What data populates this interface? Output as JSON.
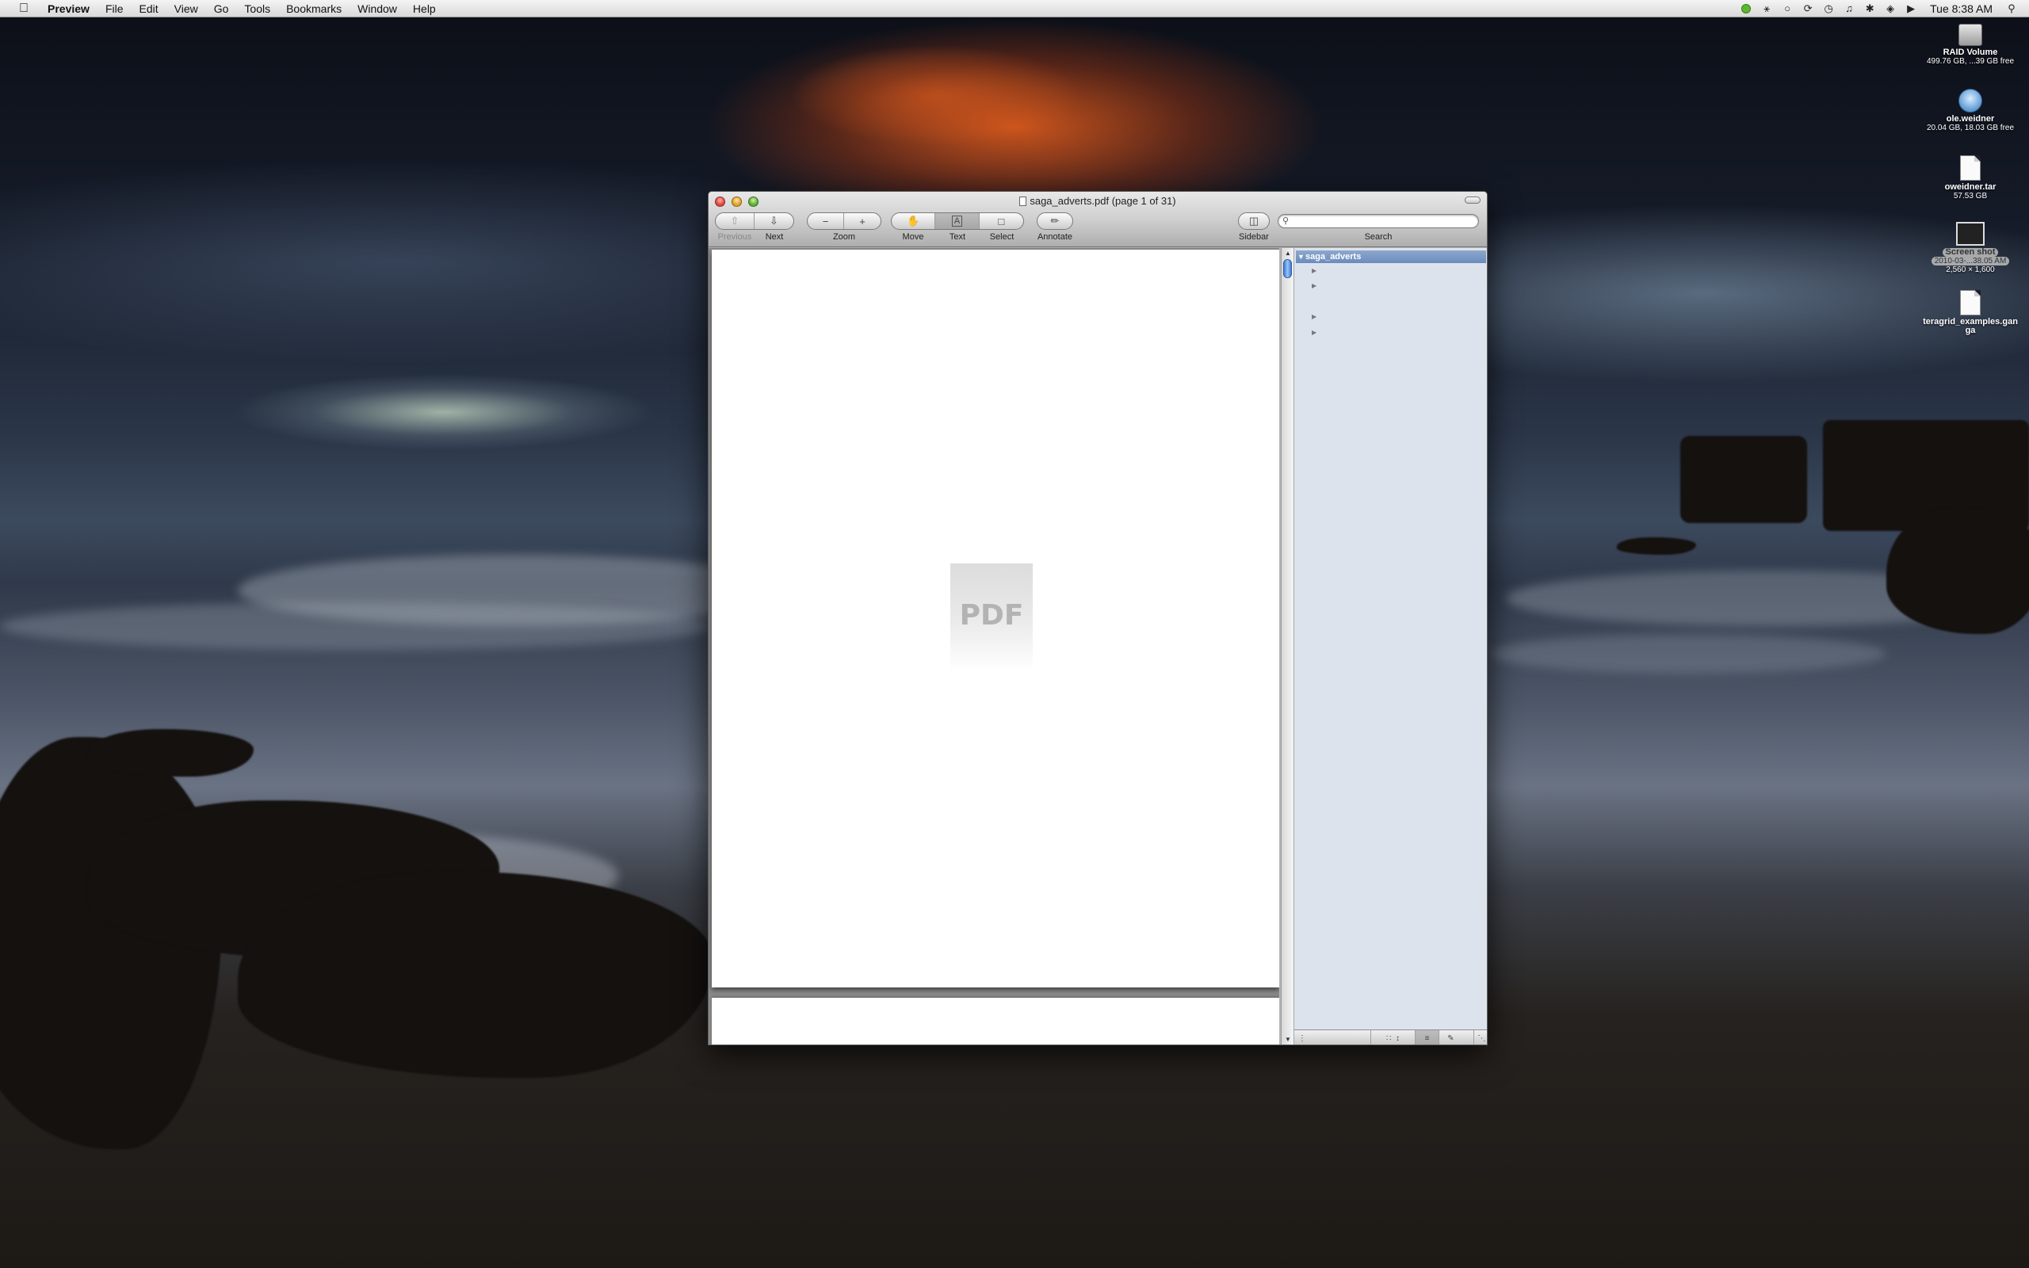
{
  "menubar": {
    "app_name": "Preview",
    "items": [
      "File",
      "Edit",
      "View",
      "Go",
      "Tools",
      "Bookmarks",
      "Window",
      "Help"
    ],
    "clock": "Tue 8:38 AM"
  },
  "desktop_icons": [
    {
      "name": "RAID Volume",
      "detail": "499.76 GB, ...39 GB free",
      "icon": "hard-drive-icon"
    },
    {
      "name": "ole.weidner",
      "detail": "20.04 GB, 18.03 GB free",
      "icon": "network-volume-icon"
    },
    {
      "name": "oweidner.tar",
      "detail": "57.53 GB",
      "icon": "document-icon"
    },
    {
      "name": "Screen shot",
      "name2": "2010-03-...38.05 AM",
      "detail": "2,560 × 1,600",
      "icon": "screenshot-icon"
    },
    {
      "name": "teragrid_examples.gan",
      "name2": "ga",
      "detail": "",
      "icon": "document-icon"
    }
  ],
  "window": {
    "title": "saga_adverts.pdf (page 1 of 31)",
    "toolbar": {
      "previous_label": "Previous",
      "next_label": "Next",
      "zoom_label": "Zoom",
      "move_label": "Move",
      "text_label": "Text",
      "select_label": "Select",
      "annotate_label": "Annotate",
      "sidebar_label": "Sidebar",
      "search_label": "Search",
      "search_value": ""
    },
    "pdf_placeholder": "PDF",
    "sidebar": {
      "root_label": "saga_adverts"
    }
  }
}
